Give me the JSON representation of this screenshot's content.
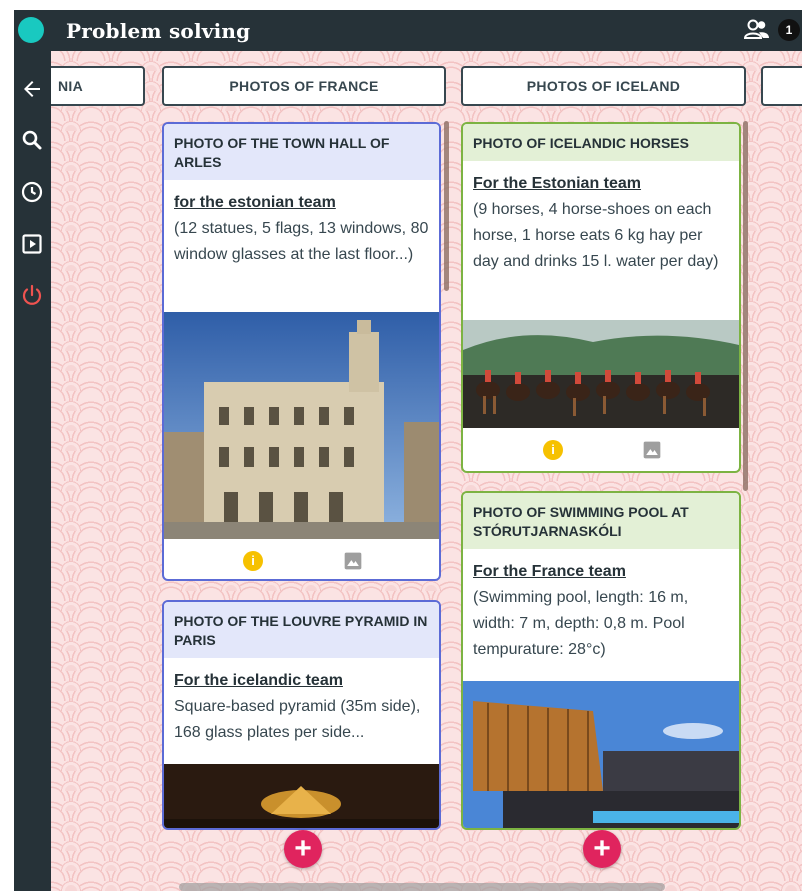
{
  "app": {
    "title": "Problem solving",
    "user_count": "1"
  },
  "colors": {
    "topbar": "#263238",
    "accent": "#e0245e",
    "logo": "#19c9c0"
  },
  "sidebar": {
    "icons": [
      "arrow-back-icon",
      "search-icon",
      "clock-icon",
      "play-box-icon",
      "power-icon"
    ]
  },
  "columns": [
    {
      "title": "NIA"
    },
    {
      "title": "PHOTOS OF FRANCE"
    },
    {
      "title": "PHOTOS OF ICELAND"
    }
  ],
  "cards": {
    "arles": {
      "title": "PHOTO OF THE TOWN HALL OF ARLES",
      "link": "for the estonian team",
      "text": "(12 statues, 5 flags, 13 windows, 80 window glasses at the last floor...)"
    },
    "louvre": {
      "title": "PHOTO OF THE LOUVRE PYRAMID IN PARIS",
      "link": "For the icelandic team",
      "text": "Square-based pyramid (35m side), 168 glass plates per side..."
    },
    "horses": {
      "title": "PHOTO OF ICELANDIC HORSES",
      "link": "For the Estonian team",
      "text": "(9 horses, 4 horse-shoes on each horse, 1 horse eats 6 kg hay per day and drinks 15 l. water per day)"
    },
    "pool": {
      "title": "PHOTO OF SWIMMING POOL AT STÓRUTJARNASKÓLI",
      "link": "For the France team",
      "text": "(Swimming pool, length: 16 m, width: 7 m, depth: 0,8 m. Pool tempurature: 28°c)"
    }
  },
  "info_icon_text": "i",
  "add_button_label": "+"
}
